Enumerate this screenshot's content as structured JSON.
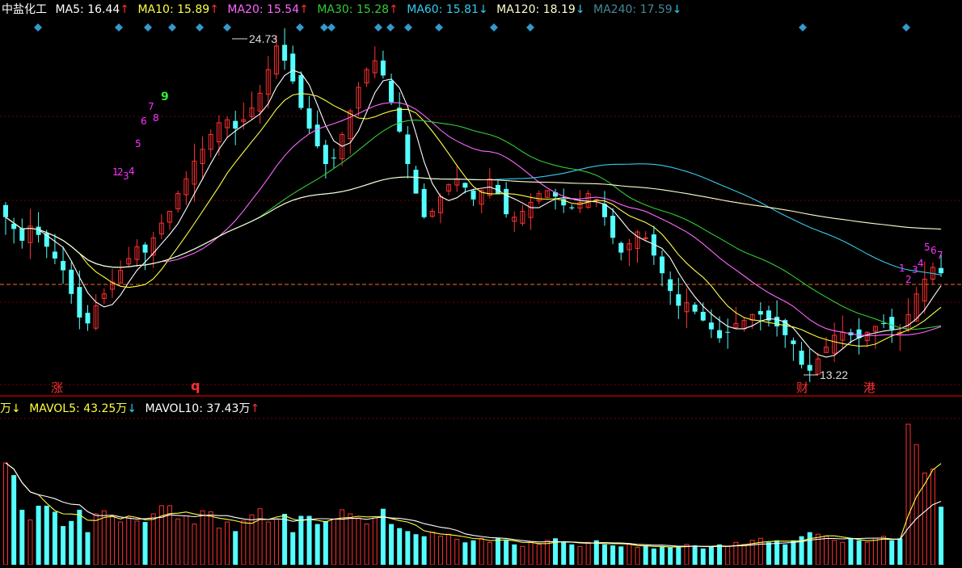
{
  "header": {
    "stock_name": "中盐化工",
    "ma_items": [
      {
        "label": "MA5:",
        "value": "16.44",
        "arrow": "↑",
        "color": "#ffffff",
        "arrow_color": "#ff3030"
      },
      {
        "label": "MA10:",
        "value": "15.89",
        "arrow": "↑",
        "color": "#ffff40",
        "arrow_color": "#ff3030"
      },
      {
        "label": "MA20:",
        "value": "15.54",
        "arrow": "↑",
        "color": "#ff66ff",
        "arrow_color": "#ff3030"
      },
      {
        "label": "MA30:",
        "value": "15.28",
        "arrow": "↑",
        "color": "#33cc33",
        "arrow_color": "#ff3030"
      },
      {
        "label": "MA60:",
        "value": "15.81",
        "arrow": "↓",
        "color": "#33ccee",
        "arrow_color": "#33ccee"
      },
      {
        "label": "MA120:",
        "value": "18.19",
        "arrow": "↓",
        "color": "#ffffcc",
        "arrow_color": "#33ccee"
      },
      {
        "label": "MA240:",
        "value": "17.59",
        "arrow": "↓",
        "color": "#448899",
        "arrow_color": "#33ccee"
      }
    ]
  },
  "volume_header": {
    "lead": "万↓",
    "items": [
      {
        "label": "MAVOL5:",
        "value": "43.25万",
        "arrow": "↓",
        "color": "#ffff40",
        "arrow_color": "#33ccee"
      },
      {
        "label": "MAVOL10:",
        "value": "37.43万",
        "arrow": "↑",
        "color": "#ffffff",
        "arrow_color": "#ff3030"
      }
    ]
  },
  "annotations": {
    "high_label": "24.73",
    "low_label": "13.22",
    "markers": [
      "涨",
      "q",
      "财",
      "港"
    ],
    "seq_left": [
      "1",
      "2",
      "3",
      "4",
      "5",
      "6",
      "7",
      "8",
      "9"
    ],
    "seq_right": [
      "1",
      "2",
      "3",
      "4",
      "5",
      "6",
      "7"
    ]
  },
  "colors": {
    "up": "#ff3030",
    "down": "#54ffff",
    "grid": "#7a0000",
    "dashed": "#ff6a1a",
    "diamond": "#3399cc",
    "separator": "#b00000"
  },
  "chart_data": {
    "type": "candlestick",
    "title": "中盐化工",
    "price_range": [
      12.6,
      25.3
    ],
    "high": 24.73,
    "low": 13.22,
    "closes": [
      18.6,
      18.2,
      17.8,
      18.3,
      18.0,
      17.6,
      17.2,
      16.8,
      16.0,
      15.2,
      15.0,
      15.6,
      16.0,
      16.4,
      16.8,
      17.2,
      17.6,
      17.4,
      17.9,
      18.4,
      18.8,
      19.4,
      19.9,
      20.5,
      20.9,
      21.4,
      21.8,
      21.9,
      21.6,
      21.9,
      22.3,
      22.8,
      23.6,
      24.4,
      23.9,
      23.2,
      22.3,
      21.6,
      21.0,
      20.4,
      20.6,
      21.4,
      22.2,
      23.0,
      23.6,
      23.9,
      23.4,
      22.5,
      21.5,
      20.4,
      19.4,
      18.6,
      18.8,
      19.3,
      19.7,
      19.9,
      19.6,
      19.2,
      19.5,
      19.9,
      19.4,
      18.7,
      18.6,
      18.8,
      19.1,
      19.4,
      19.5,
      19.3,
      19.0,
      18.9,
      19.1,
      19.4,
      19.2,
      18.6,
      17.9,
      17.4,
      17.7,
      18.1,
      17.9,
      17.3,
      16.7,
      16.1,
      15.6,
      15.7,
      15.4,
      15.1,
      14.8,
      14.5,
      14.7,
      15.0,
      15.1,
      15.3,
      15.3,
      15.1,
      14.9,
      14.6,
      14.3,
      13.6,
      13.4,
      13.8,
      14.2,
      14.6,
      14.7,
      14.6,
      14.5,
      14.7,
      14.9,
      15.0,
      14.8,
      14.7,
      15.3,
      16.0,
      16.5,
      16.9,
      16.7
    ],
    "volumes": [
      100,
      88,
      54,
      44,
      58,
      58,
      52,
      38,
      43,
      54,
      32,
      50,
      53,
      48,
      42,
      46,
      43,
      42,
      50,
      58,
      58,
      45,
      48,
      40,
      53,
      52,
      36,
      42,
      33,
      43,
      49,
      55,
      42,
      45,
      50,
      32,
      48,
      48,
      40,
      43,
      45,
      54,
      50,
      46,
      40,
      46,
      55,
      40,
      36,
      33,
      30,
      28,
      32,
      28,
      30,
      25,
      22,
      24,
      26,
      22,
      26,
      24,
      20,
      18,
      22,
      20,
      24,
      26,
      22,
      20,
      18,
      22,
      24,
      20,
      19,
      18,
      20,
      17,
      19,
      16,
      18,
      17,
      18,
      20,
      19,
      16,
      18,
      20,
      18,
      22,
      20,
      24,
      26,
      22,
      24,
      20,
      24,
      28,
      32,
      30,
      28,
      24,
      22,
      26,
      24,
      22,
      26,
      28,
      24,
      26,
      138,
      118,
      90,
      94,
      57
    ]
  }
}
